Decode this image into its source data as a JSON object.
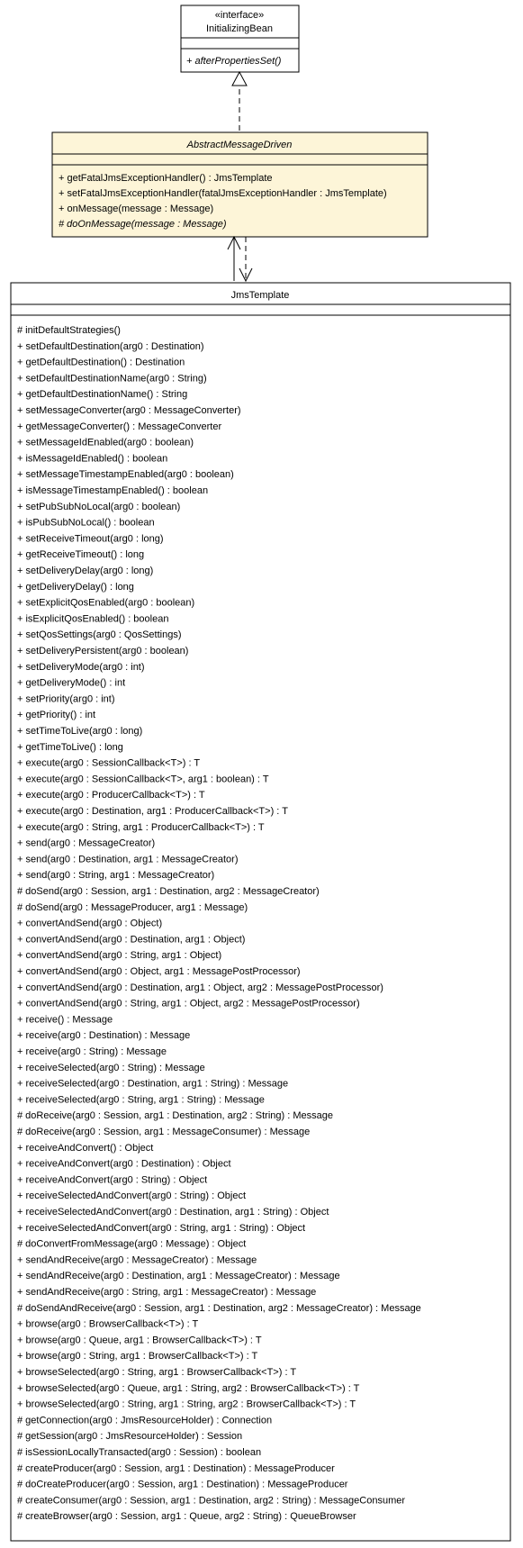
{
  "chart_data": {
    "type": "uml-class-diagram",
    "classes": [
      {
        "name": "InitializingBean",
        "kind": "interface",
        "methods": [
          "+ afterPropertiesSet()"
        ]
      },
      {
        "name": "AbstractMessageDriven",
        "kind": "abstract",
        "methods": [
          "+ getFatalJmsExceptionHandler() : JmsTemplate",
          "+ setFatalJmsExceptionHandler(fatalJmsExceptionHandler : JmsTemplate)",
          "+ onMessage(message : Message)",
          "# doOnMessage(message : Message)"
        ]
      },
      {
        "name": "JmsTemplate",
        "kind": "class",
        "methods": []
      }
    ],
    "relations": [
      {
        "from": "AbstractMessageDriven",
        "to": "InitializingBean",
        "type": "realization"
      },
      {
        "from": "JmsTemplate",
        "to": "AbstractMessageDriven",
        "type": "dependency-both"
      }
    ]
  },
  "iface": {
    "stereotype": "«interface»",
    "name": "InitializingBean",
    "m0": "+ afterPropertiesSet()"
  },
  "abs": {
    "name": "AbstractMessageDriven",
    "m0": "+ getFatalJmsExceptionHandler() : JmsTemplate",
    "m1": "+ setFatalJmsExceptionHandler(fatalJmsExceptionHandler : JmsTemplate)",
    "m2": "+ onMessage(message : Message)",
    "m3": "# doOnMessage(message : Message)"
  },
  "jms": {
    "name": "JmsTemplate",
    "m": [
      "# initDefaultStrategies()",
      "+ setDefaultDestination(arg0 : Destination)",
      "+ getDefaultDestination() : Destination",
      "+ setDefaultDestinationName(arg0 : String)",
      "+ getDefaultDestinationName() : String",
      "+ setMessageConverter(arg0 : MessageConverter)",
      "+ getMessageConverter() : MessageConverter",
      "+ setMessageIdEnabled(arg0 : boolean)",
      "+ isMessageIdEnabled() : boolean",
      "+ setMessageTimestampEnabled(arg0 : boolean)",
      "+ isMessageTimestampEnabled() : boolean",
      "+ setPubSubNoLocal(arg0 : boolean)",
      "+ isPubSubNoLocal() : boolean",
      "+ setReceiveTimeout(arg0 : long)",
      "+ getReceiveTimeout() : long",
      "+ setDeliveryDelay(arg0 : long)",
      "+ getDeliveryDelay() : long",
      "+ setExplicitQosEnabled(arg0 : boolean)",
      "+ isExplicitQosEnabled() : boolean",
      "+ setQosSettings(arg0 : QosSettings)",
      "+ setDeliveryPersistent(arg0 : boolean)",
      "+ setDeliveryMode(arg0 : int)",
      "+ getDeliveryMode() : int",
      "+ setPriority(arg0 : int)",
      "+ getPriority() : int",
      "+ setTimeToLive(arg0 : long)",
      "+ getTimeToLive() : long",
      "+ execute(arg0 : SessionCallback<T>) : T",
      "+ execute(arg0 : SessionCallback<T>, arg1 : boolean) : T",
      "+ execute(arg0 : ProducerCallback<T>) : T",
      "+ execute(arg0 : Destination, arg1 : ProducerCallback<T>) : T",
      "+ execute(arg0 : String, arg1 : ProducerCallback<T>) : T",
      "+ send(arg0 : MessageCreator)",
      "+ send(arg0 : Destination, arg1 : MessageCreator)",
      "+ send(arg0 : String, arg1 : MessageCreator)",
      "# doSend(arg0 : Session, arg1 : Destination, arg2 : MessageCreator)",
      "# doSend(arg0 : MessageProducer, arg1 : Message)",
      "+ convertAndSend(arg0 : Object)",
      "+ convertAndSend(arg0 : Destination, arg1 : Object)",
      "+ convertAndSend(arg0 : String, arg1 : Object)",
      "+ convertAndSend(arg0 : Object, arg1 : MessagePostProcessor)",
      "+ convertAndSend(arg0 : Destination, arg1 : Object, arg2 : MessagePostProcessor)",
      "+ convertAndSend(arg0 : String, arg1 : Object, arg2 : MessagePostProcessor)",
      "+ receive() : Message",
      "+ receive(arg0 : Destination) : Message",
      "+ receive(arg0 : String) : Message",
      "+ receiveSelected(arg0 : String) : Message",
      "+ receiveSelected(arg0 : Destination, arg1 : String) : Message",
      "+ receiveSelected(arg0 : String, arg1 : String) : Message",
      "# doReceive(arg0 : Session, arg1 : Destination, arg2 : String) : Message",
      "# doReceive(arg0 : Session, arg1 : MessageConsumer) : Message",
      "+ receiveAndConvert() : Object",
      "+ receiveAndConvert(arg0 : Destination) : Object",
      "+ receiveAndConvert(arg0 : String) : Object",
      "+ receiveSelectedAndConvert(arg0 : String) : Object",
      "+ receiveSelectedAndConvert(arg0 : Destination, arg1 : String) : Object",
      "+ receiveSelectedAndConvert(arg0 : String, arg1 : String) : Object",
      "# doConvertFromMessage(arg0 : Message) : Object",
      "+ sendAndReceive(arg0 : MessageCreator) : Message",
      "+ sendAndReceive(arg0 : Destination, arg1 : MessageCreator) : Message",
      "+ sendAndReceive(arg0 : String, arg1 : MessageCreator) : Message",
      "# doSendAndReceive(arg0 : Session, arg1 : Destination, arg2 : MessageCreator) : Message",
      "+ browse(arg0 : BrowserCallback<T>) : T",
      "+ browse(arg0 : Queue, arg1 : BrowserCallback<T>) : T",
      "+ browse(arg0 : String, arg1 : BrowserCallback<T>) : T",
      "+ browseSelected(arg0 : String, arg1 : BrowserCallback<T>) : T",
      "+ browseSelected(arg0 : Queue, arg1 : String, arg2 : BrowserCallback<T>) : T",
      "+ browseSelected(arg0 : String, arg1 : String, arg2 : BrowserCallback<T>) : T",
      "# getConnection(arg0 : JmsResourceHolder) : Connection",
      "# getSession(arg0 : JmsResourceHolder) : Session",
      "# isSessionLocallyTransacted(arg0 : Session) : boolean",
      "# createProducer(arg0 : Session, arg1 : Destination) : MessageProducer",
      "# doCreateProducer(arg0 : Session, arg1 : Destination) : MessageProducer",
      "# createConsumer(arg0 : Session, arg1 : Destination, arg2 : String) : MessageConsumer",
      "# createBrowser(arg0 : Session, arg1 : Queue, arg2 : String) : QueueBrowser"
    ]
  }
}
